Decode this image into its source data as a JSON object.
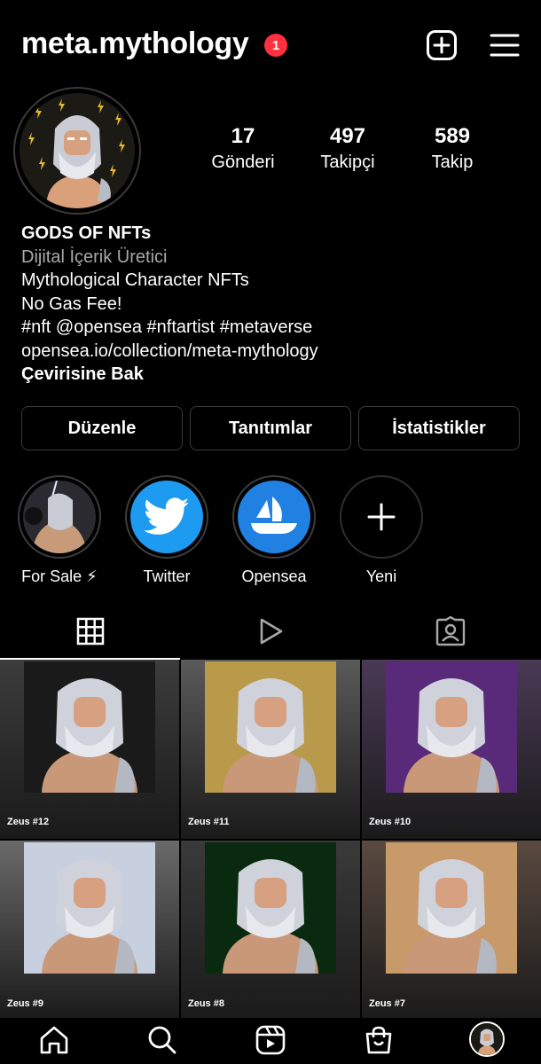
{
  "header": {
    "username": "meta.mythology",
    "notification_count": "1",
    "add_icon": "plus-square-icon",
    "menu_icon": "hamburger-menu-icon"
  },
  "profile": {
    "stats": [
      {
        "value": "17",
        "label": "Gönderi"
      },
      {
        "value": "497",
        "label": "Takipçi"
      },
      {
        "value": "589",
        "label": "Takip"
      }
    ],
    "bio": {
      "name": "GODS OF NFTs",
      "category": "Dijital İçerik Üretici",
      "line1": "Mythological Character NFTs",
      "line2": "No Gas Fee!",
      "hashtags": "#nft @opensea #nftartist #metaverse",
      "link": "opensea.io/collection/meta-mythology",
      "translate": "Çevirisine Bak"
    },
    "buttons": [
      "Düzenle",
      "Tanıtımlar",
      "İstatistikler"
    ]
  },
  "highlights": [
    {
      "label": "For Sale ⚡"
    },
    {
      "label": "Twitter"
    },
    {
      "label": "Opensea"
    },
    {
      "label": "Yeni"
    }
  ],
  "tabs": [
    {
      "icon": "grid-icon",
      "active": true
    },
    {
      "icon": "reels-play-icon",
      "active": false
    },
    {
      "icon": "tagged-person-icon",
      "active": false
    }
  ],
  "posts": [
    {
      "title": "Zeus #12",
      "bg": "#3c3c3c",
      "art": "#1a1a1a"
    },
    {
      "title": "Zeus #11",
      "bg": "#5a5a5a",
      "art": "#b89a4a"
    },
    {
      "title": "Zeus #10",
      "bg": "#4a3a55",
      "art": "#5a2a7a"
    },
    {
      "title": "Zeus #9",
      "bg": "#6a6a6a",
      "art": "#c8d0e0"
    },
    {
      "title": "Zeus #8",
      "bg": "#3a3a3a",
      "art": "#0a2a10"
    },
    {
      "title": "Zeus #7",
      "bg": "#5a4a40",
      "art": "#c89a6a"
    }
  ],
  "bottom_nav": [
    "home-icon",
    "search-icon",
    "reels-icon",
    "shop-bag-icon",
    "profile-avatar"
  ],
  "colors": {
    "background": "#000000",
    "badge": "#ff3040",
    "twitter": "#1d9bf0",
    "opensea": "#2081e2",
    "border": "#3a3a3a"
  }
}
